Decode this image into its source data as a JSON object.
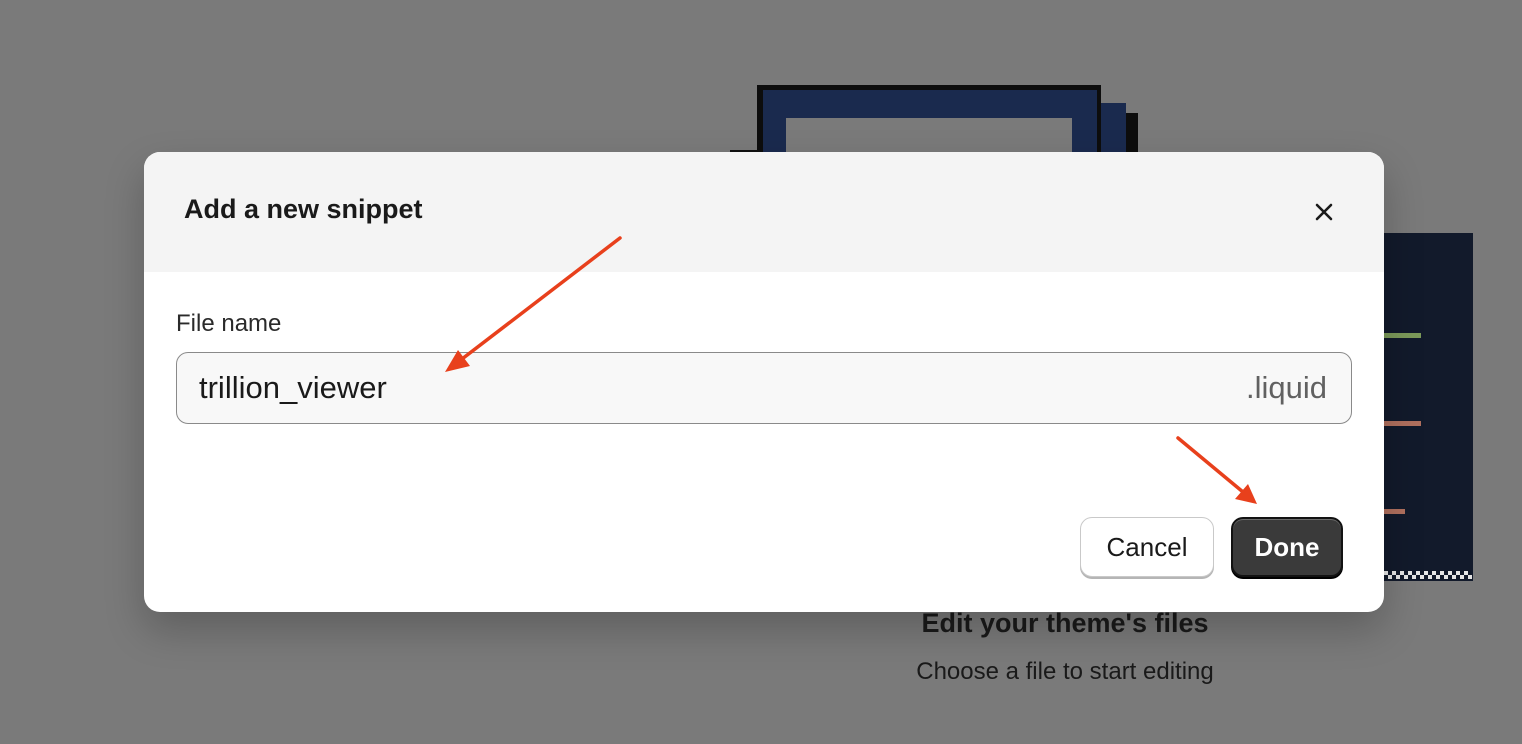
{
  "background": {
    "empty_state_title": "Edit your theme's files",
    "empty_state_subtitle": "Choose a file to start editing"
  },
  "modal": {
    "title": "Add a new snippet",
    "close_icon": "close-icon",
    "field_label": "File name",
    "file_name_value": "trillion_viewer",
    "file_suffix": ".liquid",
    "cancel_label": "Cancel",
    "done_label": "Done"
  },
  "annotations": {
    "arrow_color": "#e8401c"
  },
  "colors": {
    "overlay": "#7a7a7a",
    "done_button": "#3a3a3a",
    "header_bg": "#f4f4f4"
  }
}
